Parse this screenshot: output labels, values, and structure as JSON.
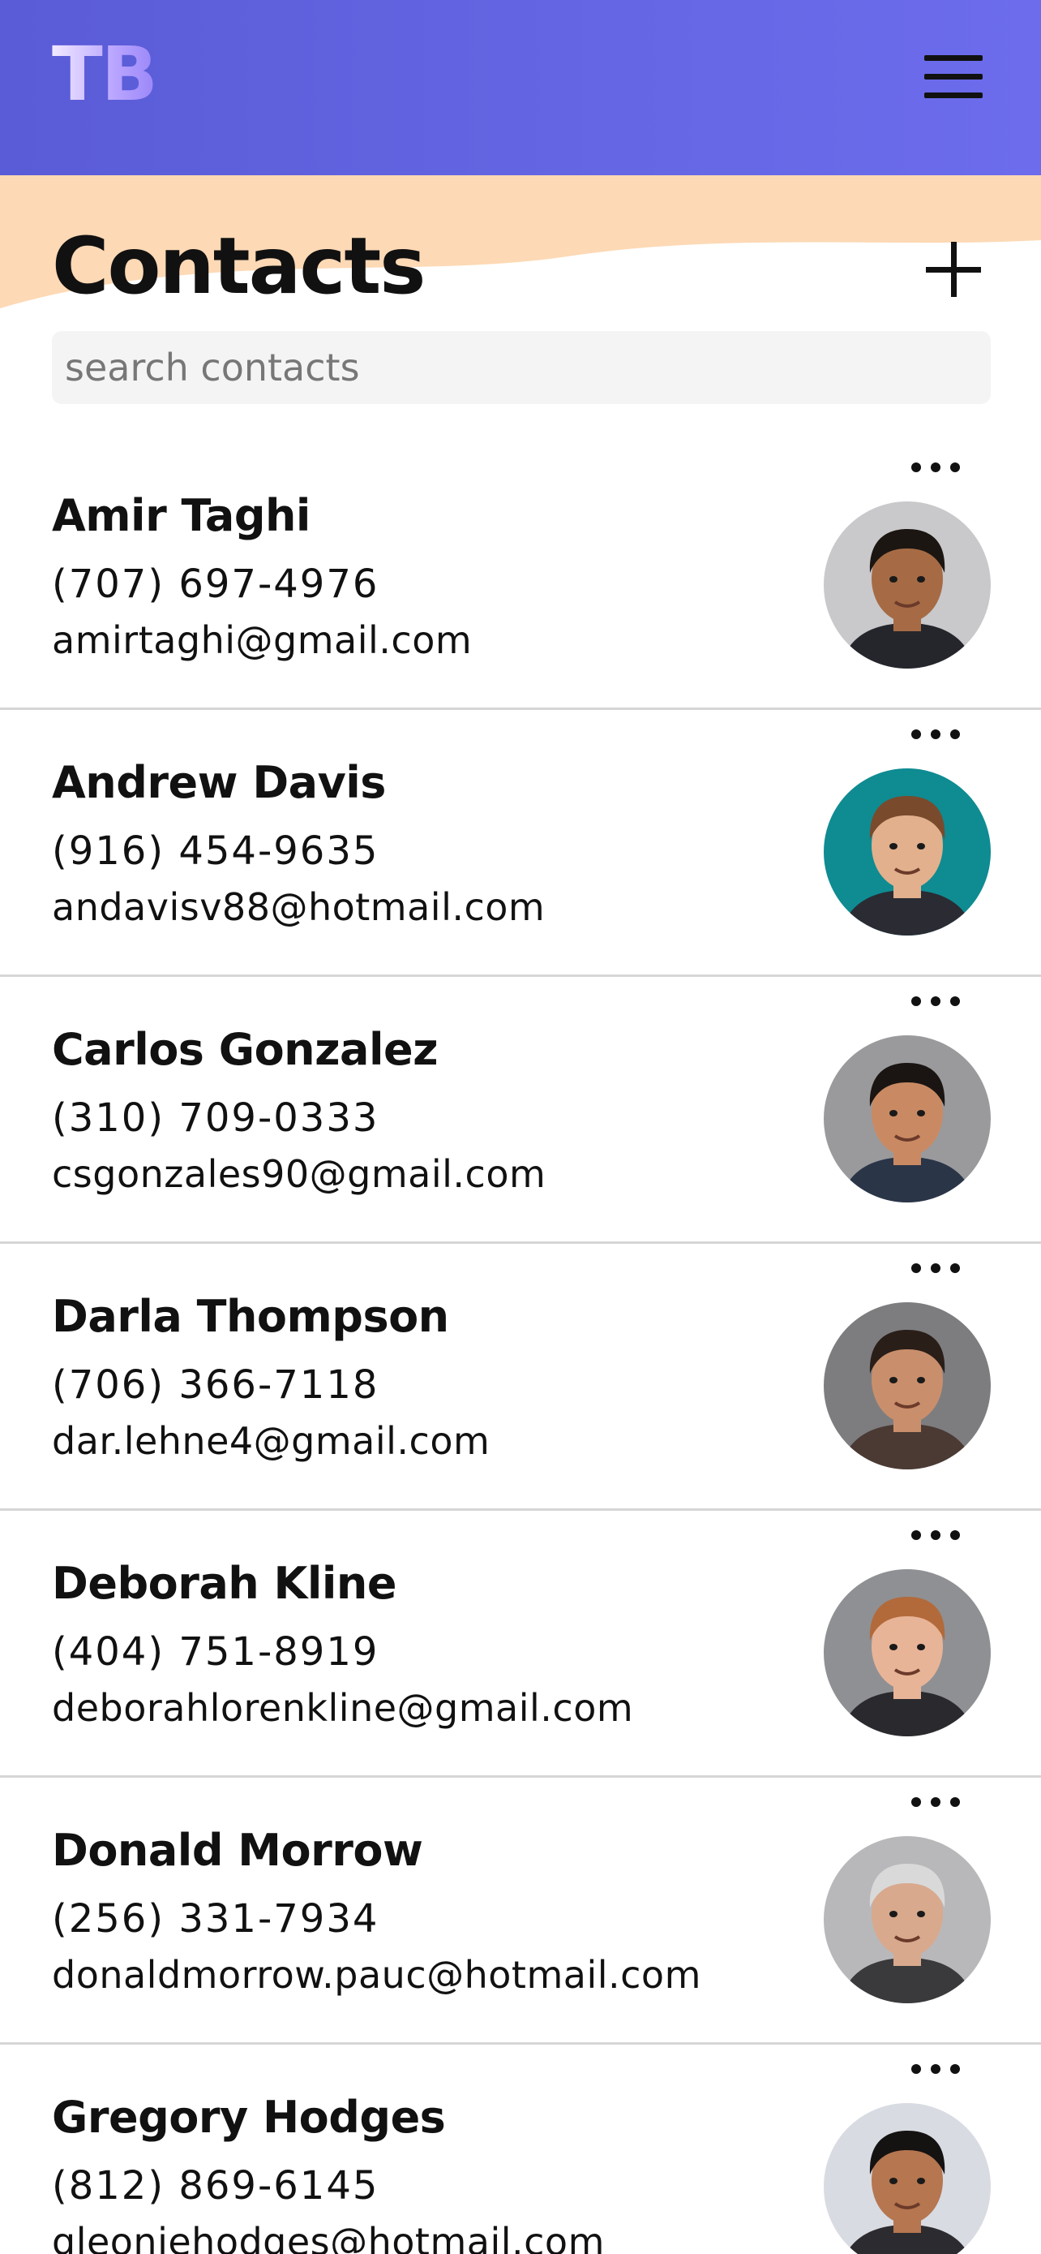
{
  "header": {
    "logo_text": "TB",
    "menu_icon": "hamburger-menu-icon"
  },
  "page": {
    "title": "Contacts",
    "add_icon": "plus-icon"
  },
  "search": {
    "placeholder": "search contacts",
    "value": ""
  },
  "colors": {
    "header_gradient_start": "#5a5bd6",
    "header_gradient_end": "#6c6cec",
    "wave": "#fdd9b5"
  },
  "contacts": [
    {
      "name": "Amir Taghi",
      "phone": "(707) 697-4976",
      "email": "amirtaghi@gmail.com",
      "avatar_bg": "#c9c9cc",
      "skin": "#a66b45",
      "hair": "#1c1612",
      "shirt": "#25262c"
    },
    {
      "name": "Andrew Davis",
      "phone": "(916) 454-9635",
      "email": "andavisv88@hotmail.com",
      "avatar_bg": "#0f8b92",
      "skin": "#e2b08c",
      "hair": "#7a4a2c",
      "shirt": "#2a2b33"
    },
    {
      "name": "Carlos Gonzalez",
      "phone": "(310) 709-0333",
      "email": "csgonzales90@gmail.com",
      "avatar_bg": "#9a9a9c",
      "skin": "#c98a63",
      "hair": "#1a1512",
      "shirt": "#2a3548"
    },
    {
      "name": "Darla Thompson",
      "phone": "(706) 366-7118",
      "email": "dar.lehne4@gmail.com",
      "avatar_bg": "#7d7d80",
      "skin": "#c98f6c",
      "hair": "#2a1e18",
      "shirt": "#4a3a33"
    },
    {
      "name": "Deborah Kline",
      "phone": "(404) 751-8919",
      "email": "deborahlorenkline@gmail.com",
      "avatar_bg": "#8f9094",
      "skin": "#e8b497",
      "hair": "#b26a3a",
      "shirt": "#2a2a2e"
    },
    {
      "name": "Donald Morrow",
      "phone": "(256) 331-7934",
      "email": "donaldmorrow.pauc@hotmail.com",
      "avatar_bg": "#b8b8bb",
      "skin": "#d8a98d",
      "hair": "#d9d9d9",
      "shirt": "#3a3a3c"
    },
    {
      "name": "Gregory Hodges",
      "phone": "(812) 869-6145",
      "email": "gleoniehodges@hotmail.com",
      "avatar_bg": "#d8dbe2",
      "skin": "#b57650",
      "hair": "#151212",
      "shirt": "#2c2c30"
    }
  ]
}
